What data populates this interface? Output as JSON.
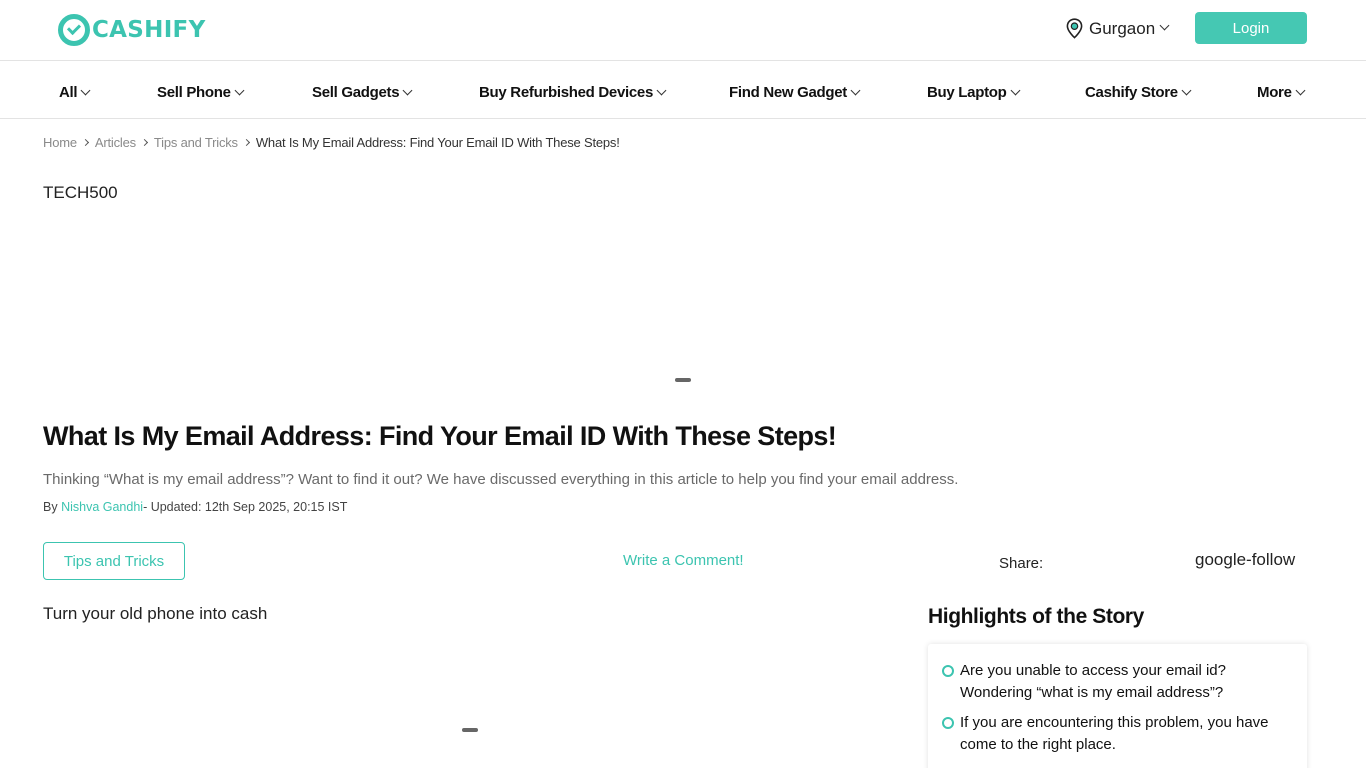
{
  "header": {
    "logo_text": "CASHIFY",
    "location": "Gurgaon",
    "login_label": "Login",
    "accent_color": "#45c8b3"
  },
  "nav": {
    "items": [
      {
        "label": "All"
      },
      {
        "label": "Sell Phone"
      },
      {
        "label": "Sell Gadgets"
      },
      {
        "label": "Buy Refurbished Devices"
      },
      {
        "label": "Find New Gadget"
      },
      {
        "label": "Buy Laptop"
      },
      {
        "label": "Cashify Store"
      },
      {
        "label": "More"
      }
    ]
  },
  "breadcrumb": {
    "items": [
      "Home",
      "Articles",
      "Tips and Tricks"
    ],
    "current": "What Is My Email Address: Find Your Email ID With These Steps!"
  },
  "banner": {
    "alt": "TECH500"
  },
  "article": {
    "title": "What Is My Email Address: Find Your Email ID With These Steps!",
    "subtitle": "Thinking “What is my email address”? Want to find it out? We have discussed everything in this article to help you find your email address.",
    "by_label": "By ",
    "author": "Nishva Gandhi",
    "updated": "- Updated: 12th Sep 2025, 20:15 IST",
    "category": "Tips and Tricks",
    "comment_label": "Write a Comment!",
    "share_label": "Share:",
    "google_follow_alt": "google-follow",
    "promo_alt": "Turn your old phone into cash"
  },
  "highlights": {
    "title": "Highlights of the Story",
    "items": [
      "Are you unable to access your email id? Wondering “what is my email address”?",
      "If you are encountering this problem, you have come to the right place."
    ]
  }
}
